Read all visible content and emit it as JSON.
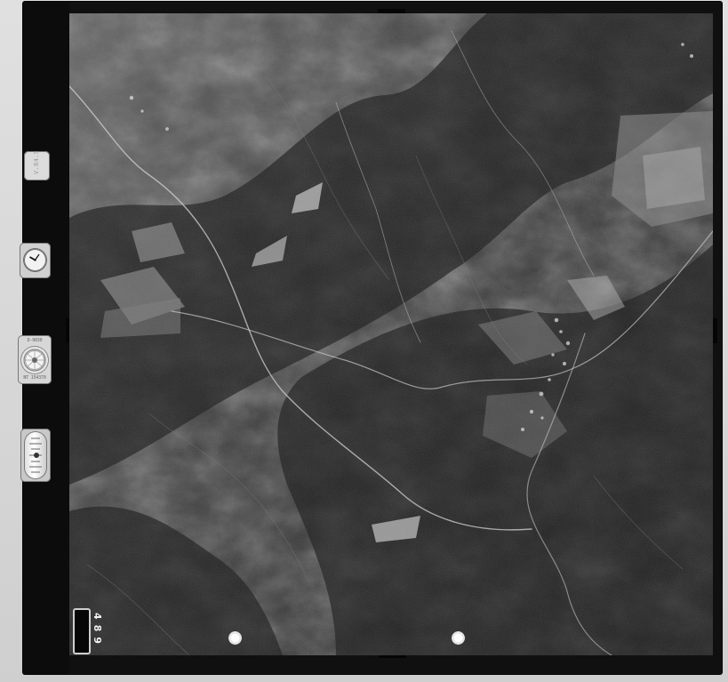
{
  "photo": {
    "type": "black-and-white aerial photograph",
    "subject": "wooded hills and valleys with scattered fields and small settlements"
  },
  "side_panel": {
    "counter_text": "V.84.S2",
    "altimeter_top": "D-9830",
    "altimeter_bottom": "NT 154370",
    "instrument_icons": [
      "clock-icon",
      "altimeter-icon",
      "level-icon"
    ]
  },
  "frame": {
    "number": "489"
  },
  "colors": {
    "film_border": "#101010",
    "paper": "#d9d9d9"
  }
}
